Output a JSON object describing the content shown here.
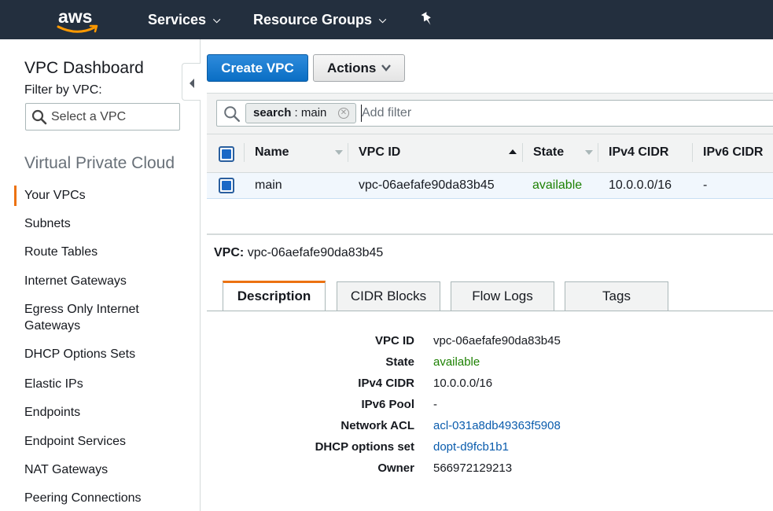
{
  "topnav": {
    "logo_text": "aws",
    "services": "Services",
    "resource_groups": "Resource Groups"
  },
  "sidebar": {
    "title": "VPC Dashboard",
    "filter_label": "Filter by VPC:",
    "select_placeholder": "Select a VPC",
    "section": "Virtual Private Cloud",
    "items": [
      {
        "label": "Your VPCs",
        "active": true
      },
      {
        "label": "Subnets"
      },
      {
        "label": "Route Tables"
      },
      {
        "label": "Internet Gateways"
      },
      {
        "label": "Egress Only Internet\nGateways"
      },
      {
        "label": "DHCP Options Sets"
      },
      {
        "label": "Elastic IPs"
      },
      {
        "label": "Endpoints"
      },
      {
        "label": "Endpoint Services"
      },
      {
        "label": "NAT Gateways"
      },
      {
        "label": "Peering Connections"
      }
    ]
  },
  "toolbar": {
    "create_label": "Create VPC",
    "actions_label": "Actions"
  },
  "filter": {
    "token_key": "search",
    "token_value": ": main",
    "placeholder": "Add filter"
  },
  "table": {
    "columns": [
      "Name",
      "VPC ID",
      "State",
      "IPv4 CIDR",
      "IPv6 CIDR"
    ],
    "rows": [
      {
        "name": "main",
        "vpc_id": "vpc-06aefafe90da83b45",
        "state": "available",
        "ipv4": "10.0.0.0/16",
        "ipv6": "-"
      }
    ]
  },
  "detail": {
    "label": "VPC:",
    "vpc_id": "vpc-06aefafe90da83b45",
    "tabs": [
      "Description",
      "CIDR Blocks",
      "Flow Logs",
      "Tags"
    ],
    "fields": [
      {
        "key": "VPC ID",
        "value": "vpc-06aefafe90da83b45"
      },
      {
        "key": "State",
        "value": "available"
      },
      {
        "key": "IPv4 CIDR",
        "value": "10.0.0.0/16"
      },
      {
        "key": "IPv6 Pool",
        "value": "-"
      },
      {
        "key": "Network ACL",
        "value": "acl-031a8db49363f5908"
      },
      {
        "key": "DHCP options set",
        "value": "dopt-d9fcb1b1"
      },
      {
        "key": "Owner",
        "value": "566972129213"
      }
    ]
  },
  "colors": {
    "nav_bg": "#232f3e",
    "primary": "#0a6ec4",
    "accent": "#ec7211",
    "status_available": "#1d8102",
    "link": "#0a5cad"
  }
}
